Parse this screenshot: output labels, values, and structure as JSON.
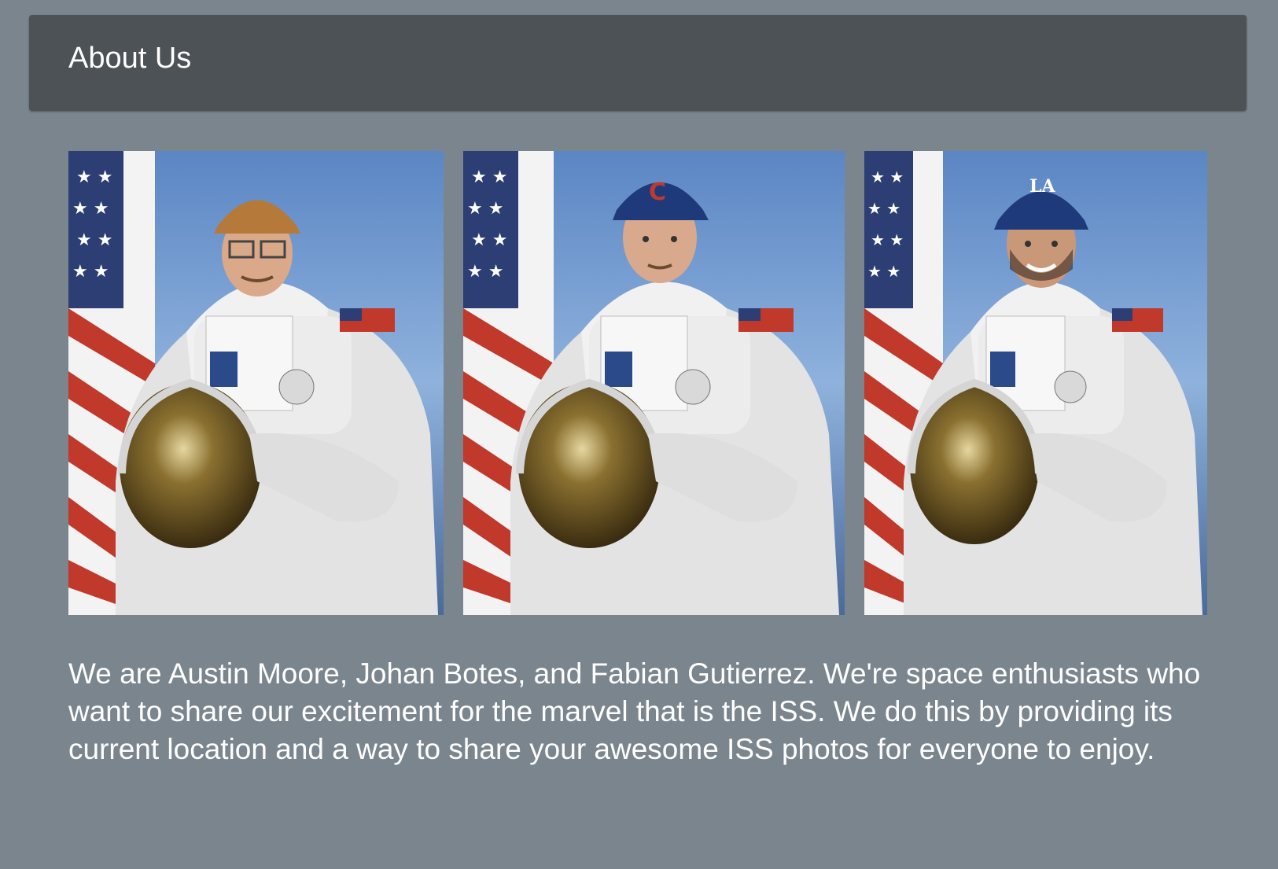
{
  "header": {
    "title": "About Us"
  },
  "team_photos": [
    {
      "icon": "astronaut-photo",
      "cap_color": "#b57a3a",
      "cap_logo": "",
      "glasses": true
    },
    {
      "icon": "astronaut-photo",
      "cap_color": "#1e3a7a",
      "cap_logo": "C",
      "glasses": false
    },
    {
      "icon": "astronaut-photo",
      "cap_color": "#1e3a7a",
      "cap_logo": "LA",
      "glasses": false
    }
  ],
  "about": {
    "text": "We are Austin Moore, Johan Botes, and Fabian Gutierrez. We're space enthusiasts who want to share our excitement for the marvel that is the ISS. We do this by providing its current location and a way to share your awesome ISS photos for everyone to enjoy."
  },
  "colors": {
    "page_background": "#7b858d",
    "header_background": "#4d5257",
    "text": "#ffffff"
  }
}
